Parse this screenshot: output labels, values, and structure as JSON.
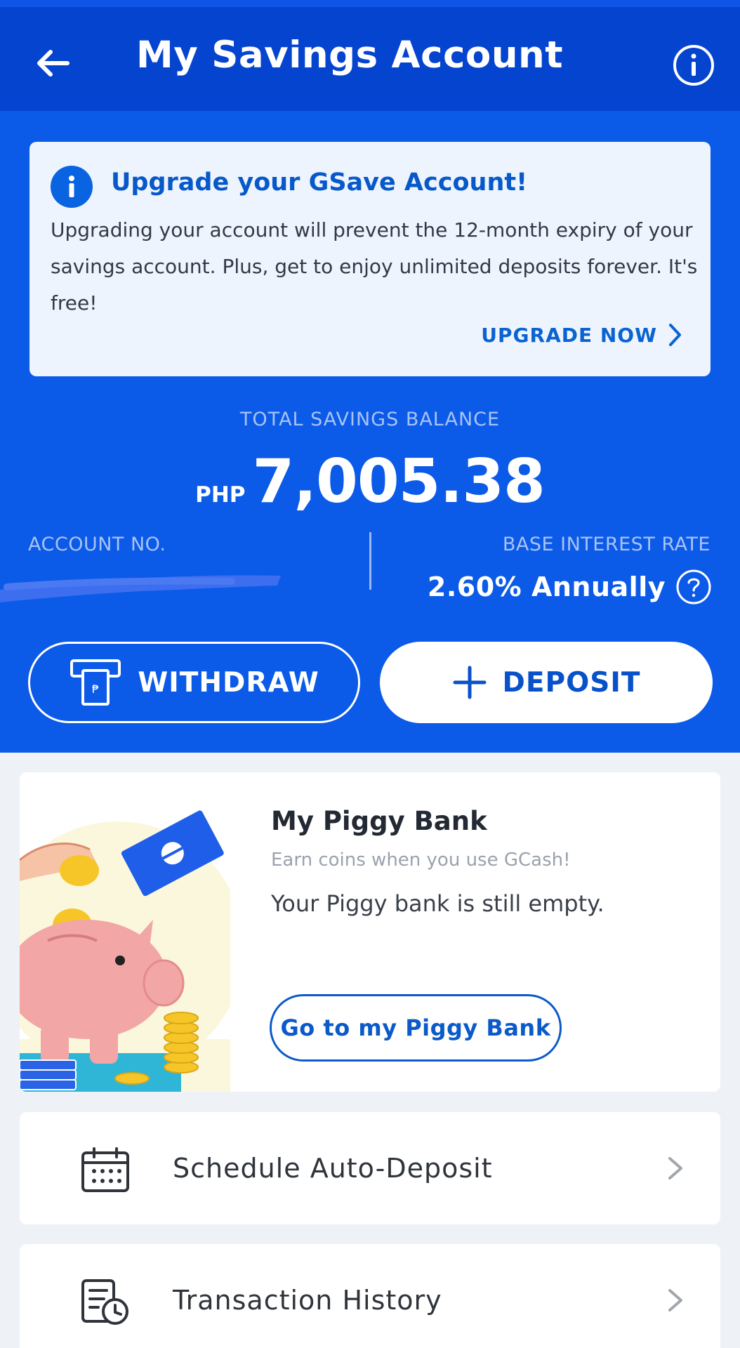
{
  "header": {
    "title": "My Savings Account",
    "back_icon": "arrow-left-icon",
    "info_icon": "info-circle-icon",
    "bg_color": "#0544cf"
  },
  "upgrade_banner": {
    "title": "Upgrade your GSave Account!",
    "body": "Upgrading your account will prevent the 12-month expiry of your savings account. Plus, get to enjoy unlimited deposits forever. It's free!",
    "cta": "UPGRADE NOW"
  },
  "balance": {
    "label": "TOTAL SAVINGS BALANCE",
    "currency": "PHP",
    "amount": "7,005.38"
  },
  "account": {
    "label": "ACCOUNT NO.",
    "value_redacted": true
  },
  "interest": {
    "label": "BASE INTEREST RATE",
    "value": "2.60% Annually"
  },
  "actions": {
    "withdraw": "WITHDRAW",
    "deposit": "DEPOSIT"
  },
  "piggy": {
    "title": "My Piggy Bank",
    "subtitle": "Earn coins when you use GCash!",
    "status": "Your Piggy bank is still empty.",
    "button": "Go to my Piggy Bank"
  },
  "menu": [
    {
      "label": "Schedule Auto-Deposit",
      "icon": "calendar-icon"
    },
    {
      "label": "Transaction History",
      "icon": "history-clock-icon"
    }
  ],
  "colors": {
    "primary": "#0b5ae8",
    "header": "#0544cf",
    "link": "#0b5ac9"
  }
}
